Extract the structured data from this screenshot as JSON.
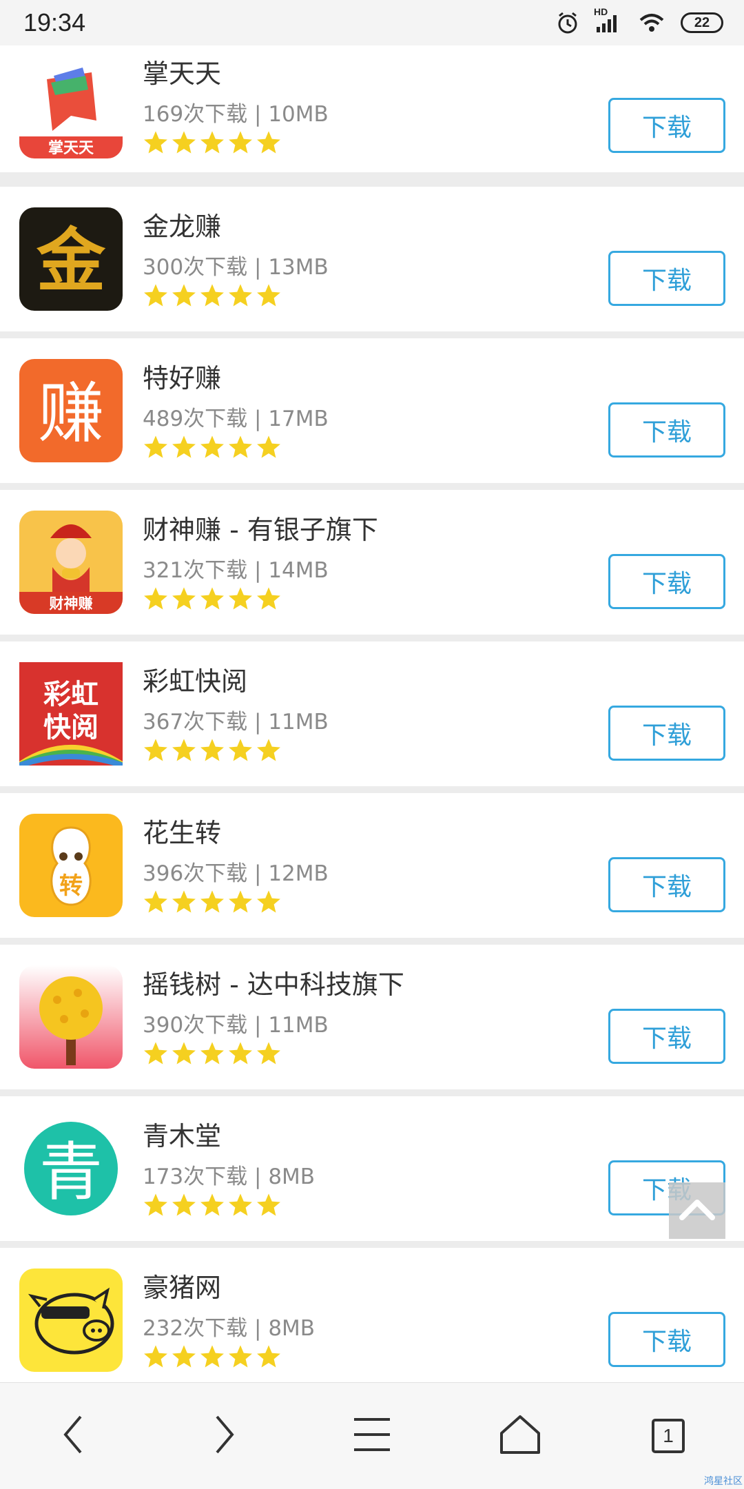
{
  "status_bar": {
    "time": "19:34",
    "network": "HD",
    "battery": "22"
  },
  "download_label": "下载",
  "apps": [
    {
      "name": "掌天天",
      "meta": "169次下载 | 10MB",
      "rating": 5,
      "icon": "zhangtiantian-app-icon",
      "icon_text": "掌天天"
    },
    {
      "name": "金龙赚",
      "meta": "300次下载 | 13MB",
      "rating": 5,
      "icon": "jinlongzhuan-app-icon",
      "icon_text": "金"
    },
    {
      "name": "特好赚",
      "meta": "489次下载 | 17MB",
      "rating": 5,
      "icon": "tehaozhuan-app-icon",
      "icon_text": "赚"
    },
    {
      "name": "财神赚 - 有银子旗下",
      "meta": "321次下载 | 14MB",
      "rating": 5,
      "icon": "caishenzhuan-app-icon",
      "icon_text": "财神赚"
    },
    {
      "name": "彩虹快阅",
      "meta": "367次下载 | 11MB",
      "rating": 5,
      "icon": "caihongkuaiyue-app-icon",
      "icon_text": "彩虹快阅"
    },
    {
      "name": "花生转",
      "meta": "396次下载 | 12MB",
      "rating": 5,
      "icon": "huashengzhuan-app-icon",
      "icon_text": "转"
    },
    {
      "name": "摇钱树 - 达中科技旗下",
      "meta": "390次下载 | 11MB",
      "rating": 5,
      "icon": "yaoqianshu-app-icon",
      "icon_text": ""
    },
    {
      "name": "青木堂",
      "meta": "173次下载 | 8MB",
      "rating": 5,
      "icon": "qingmutang-app-icon",
      "icon_text": "青"
    },
    {
      "name": "豪猪网",
      "meta": "232次下载 | 8MB",
      "rating": 5,
      "icon": "haozhuwang-app-icon",
      "icon_text": ""
    }
  ],
  "bottom_nav": {
    "tab_count": "1"
  },
  "watermark": "鸿星社区",
  "colors": {
    "star": "#f5d020",
    "button_border": "#35a8e0",
    "button_text": "#2f9fd8"
  }
}
